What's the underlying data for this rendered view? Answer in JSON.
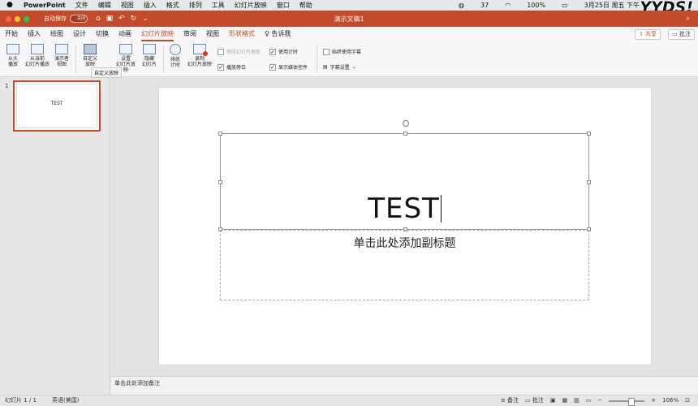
{
  "menubar": {
    "app": "PowerPoint",
    "items": [
      "文件",
      "编辑",
      "视图",
      "插入",
      "格式",
      "排列",
      "工具",
      "幻灯片放映",
      "窗口",
      "帮助"
    ],
    "battery": "100%",
    "clock": "3月25日 周五 下午",
    "wechat_count": "37",
    "sticker": "YYDS!"
  },
  "titlebar": {
    "autosave_label": "自动保存",
    "autosave_state": "关闭",
    "doc_title": "演示文稿1"
  },
  "tabs": [
    "开始",
    "插入",
    "绘图",
    "设计",
    "切换",
    "动画",
    "幻灯片放映",
    "审阅",
    "视图",
    "形状格式"
  ],
  "active_tab": "幻灯片放映",
  "tell_me": "告诉我",
  "share_label": "共享",
  "comment_label": "批注",
  "ribbon": {
    "from_start": "从头\n播放",
    "from_current": "从当前\n幻灯片播放",
    "presenter": "演示者\n视图",
    "custom": "自定义\n放映",
    "setup": "设置\n幻灯片放映",
    "hide": "隐藏\n幻灯片",
    "rehearse": "排练\n计时",
    "record": "录制\n幻灯片放映",
    "keep_updated": "保持幻灯片更新",
    "play_narration": "播放旁白",
    "use_timings": "使用计时",
    "show_media": "显示媒体控件",
    "always_subtitles": "始终使用字幕",
    "subtitle_settings": "字幕设置",
    "tooltip": "自定义放映"
  },
  "thumbnail": {
    "number": "1",
    "text": "TEST"
  },
  "slide": {
    "title": "TEST",
    "subtitle_placeholder": "单击此处添加副标题"
  },
  "notes_placeholder": "单击此处添加备注",
  "status": {
    "slide_of": "幻灯片 1 / 1",
    "language": "英语(美国)",
    "notes": "备注",
    "comments": "批注",
    "zoom": "106%"
  },
  "colors": {
    "accent": "#c34a2a"
  }
}
